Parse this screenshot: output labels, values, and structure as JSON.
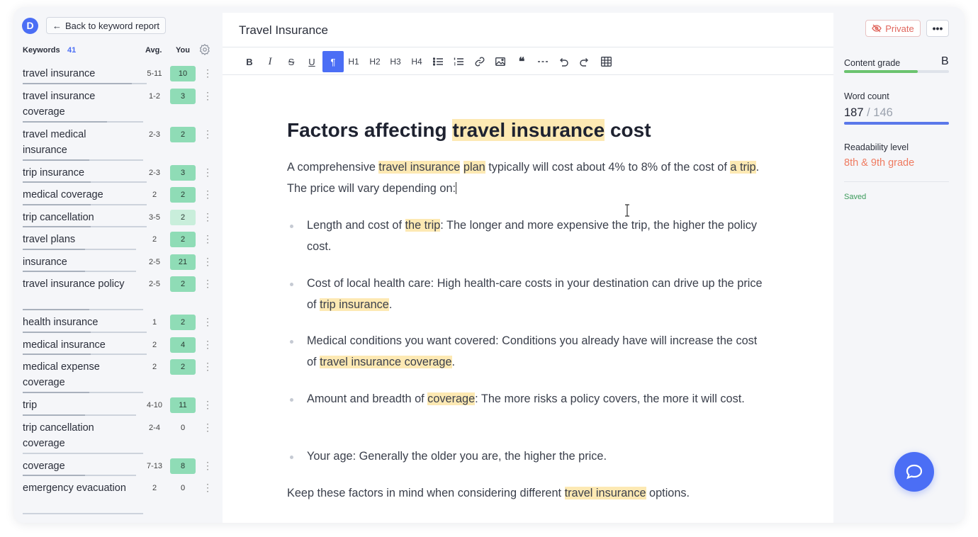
{
  "app": {
    "logo_letter": "D"
  },
  "header": {
    "back_label": "Back to keyword report"
  },
  "keywords_panel": {
    "title": "Keywords",
    "count": "41",
    "col_avg": "Avg.",
    "col_you": "You",
    "items": [
      {
        "name": "travel insurance",
        "avg": "5-11",
        "you": "10",
        "level": "g1",
        "progress": 0.88
      },
      {
        "name": "travel insurance coverage",
        "avg": "1-2",
        "you": "3",
        "level": "g1",
        "progress": 0.7
      },
      {
        "name": "travel medical insurance",
        "avg": "2-3",
        "you": "2",
        "level": "g1",
        "progress": 0.55
      },
      {
        "name": "trip insurance",
        "avg": "2-3",
        "you": "3",
        "level": "g1",
        "progress": 0.55
      },
      {
        "name": "medical coverage",
        "avg": "2",
        "you": "2",
        "level": "g1",
        "progress": 0.55
      },
      {
        "name": "trip cancellation",
        "avg": "3-5",
        "you": "2",
        "level": "g2",
        "progress": 0.55
      },
      {
        "name": "travel plans",
        "avg": "2",
        "you": "2",
        "level": "g1",
        "progress": 0.55
      },
      {
        "name": "insurance",
        "avg": "2-5",
        "you": "21",
        "level": "g1",
        "progress": 0.55
      },
      {
        "name": "travel insurance policy",
        "avg": "2-5",
        "you": "2",
        "level": "g1",
        "progress": 0.55
      },
      {
        "name": "health insurance",
        "avg": "1",
        "you": "2",
        "level": "g1",
        "progress": 0.55
      },
      {
        "name": "medical insurance",
        "avg": "2",
        "you": "4",
        "level": "g1",
        "progress": 0.55
      },
      {
        "name": "medical expense coverage",
        "avg": "2",
        "you": "2",
        "level": "g1",
        "progress": 0.55
      },
      {
        "name": "trip",
        "avg": "4-10",
        "you": "11",
        "level": "g1",
        "progress": 0.55
      },
      {
        "name": "trip cancellation coverage",
        "avg": "2-4",
        "you": "0",
        "level": "g0",
        "progress": 0.0
      },
      {
        "name": "coverage",
        "avg": "7-13",
        "you": "8",
        "level": "g1",
        "progress": 0.55
      },
      {
        "name": "emergency evacuation",
        "avg": "2",
        "you": "0",
        "level": "g0",
        "progress": 0.0
      }
    ]
  },
  "editor": {
    "doc_title": "Travel Insurance",
    "toolbar": [
      "B",
      "I",
      "S",
      "U",
      "¶",
      "H1",
      "H2",
      "H3",
      "H4",
      "bullet-list",
      "numbered-list",
      "link",
      "image",
      "quote",
      "divider",
      "undo",
      "redo",
      "table"
    ],
    "heading_pre": "Factors affecting ",
    "heading_hl": "travel insurance",
    "heading_post": " cost",
    "p1": {
      "a": "A comprehensive ",
      "hl1": "travel insurance",
      "b": " ",
      "hl2": "plan",
      "c": " typically will cost about 4% to 8% of the cost of ",
      "hl3": "a trip",
      "d": ". The price will vary depending on:"
    },
    "bullets": [
      {
        "a": "Length and cost of ",
        "hl": "the trip",
        "b": ": The longer and more expensive the trip, the higher the policy cost."
      },
      {
        "a": "Cost of local health care: High health-care costs in your destination can drive up the price of ",
        "hl": "trip insurance",
        "b": "."
      },
      {
        "a": "Medical conditions you want covered: Conditions you already have will increase the cost of ",
        "hl": "travel insurance coverage",
        "b": "."
      },
      {
        "a": "Amount and breadth of ",
        "hl": "coverage",
        "b": ": The more risks a policy covers, the more it will cost."
      },
      {
        "a": "Your age: Generally the older you are, the higher the price.",
        "hl": "",
        "b": ""
      }
    ],
    "p2": {
      "a": "Keep these factors in mind when considering different ",
      "hl": "travel insurance",
      "b": " options."
    }
  },
  "sidebar_right": {
    "private_label": "Private",
    "more_label": "•••",
    "content_grade_label": "Content grade",
    "content_grade": "B",
    "content_grade_progress": 0.7,
    "word_count_label": "Word count",
    "word_count": "187",
    "word_count_sep": " / ",
    "word_count_target": "146",
    "word_count_progress": 1.0,
    "readability_label": "Readability level",
    "readability_value": "8th & 9th grade",
    "saved_label": "Saved"
  },
  "colors": {
    "accent": "#4b6ef5",
    "highlight": "#fde9b3",
    "keyword_good": "#8fdcb6",
    "keyword_partial": "#c9eedb",
    "readability": "#ef7b61",
    "private": "#e0665d"
  }
}
